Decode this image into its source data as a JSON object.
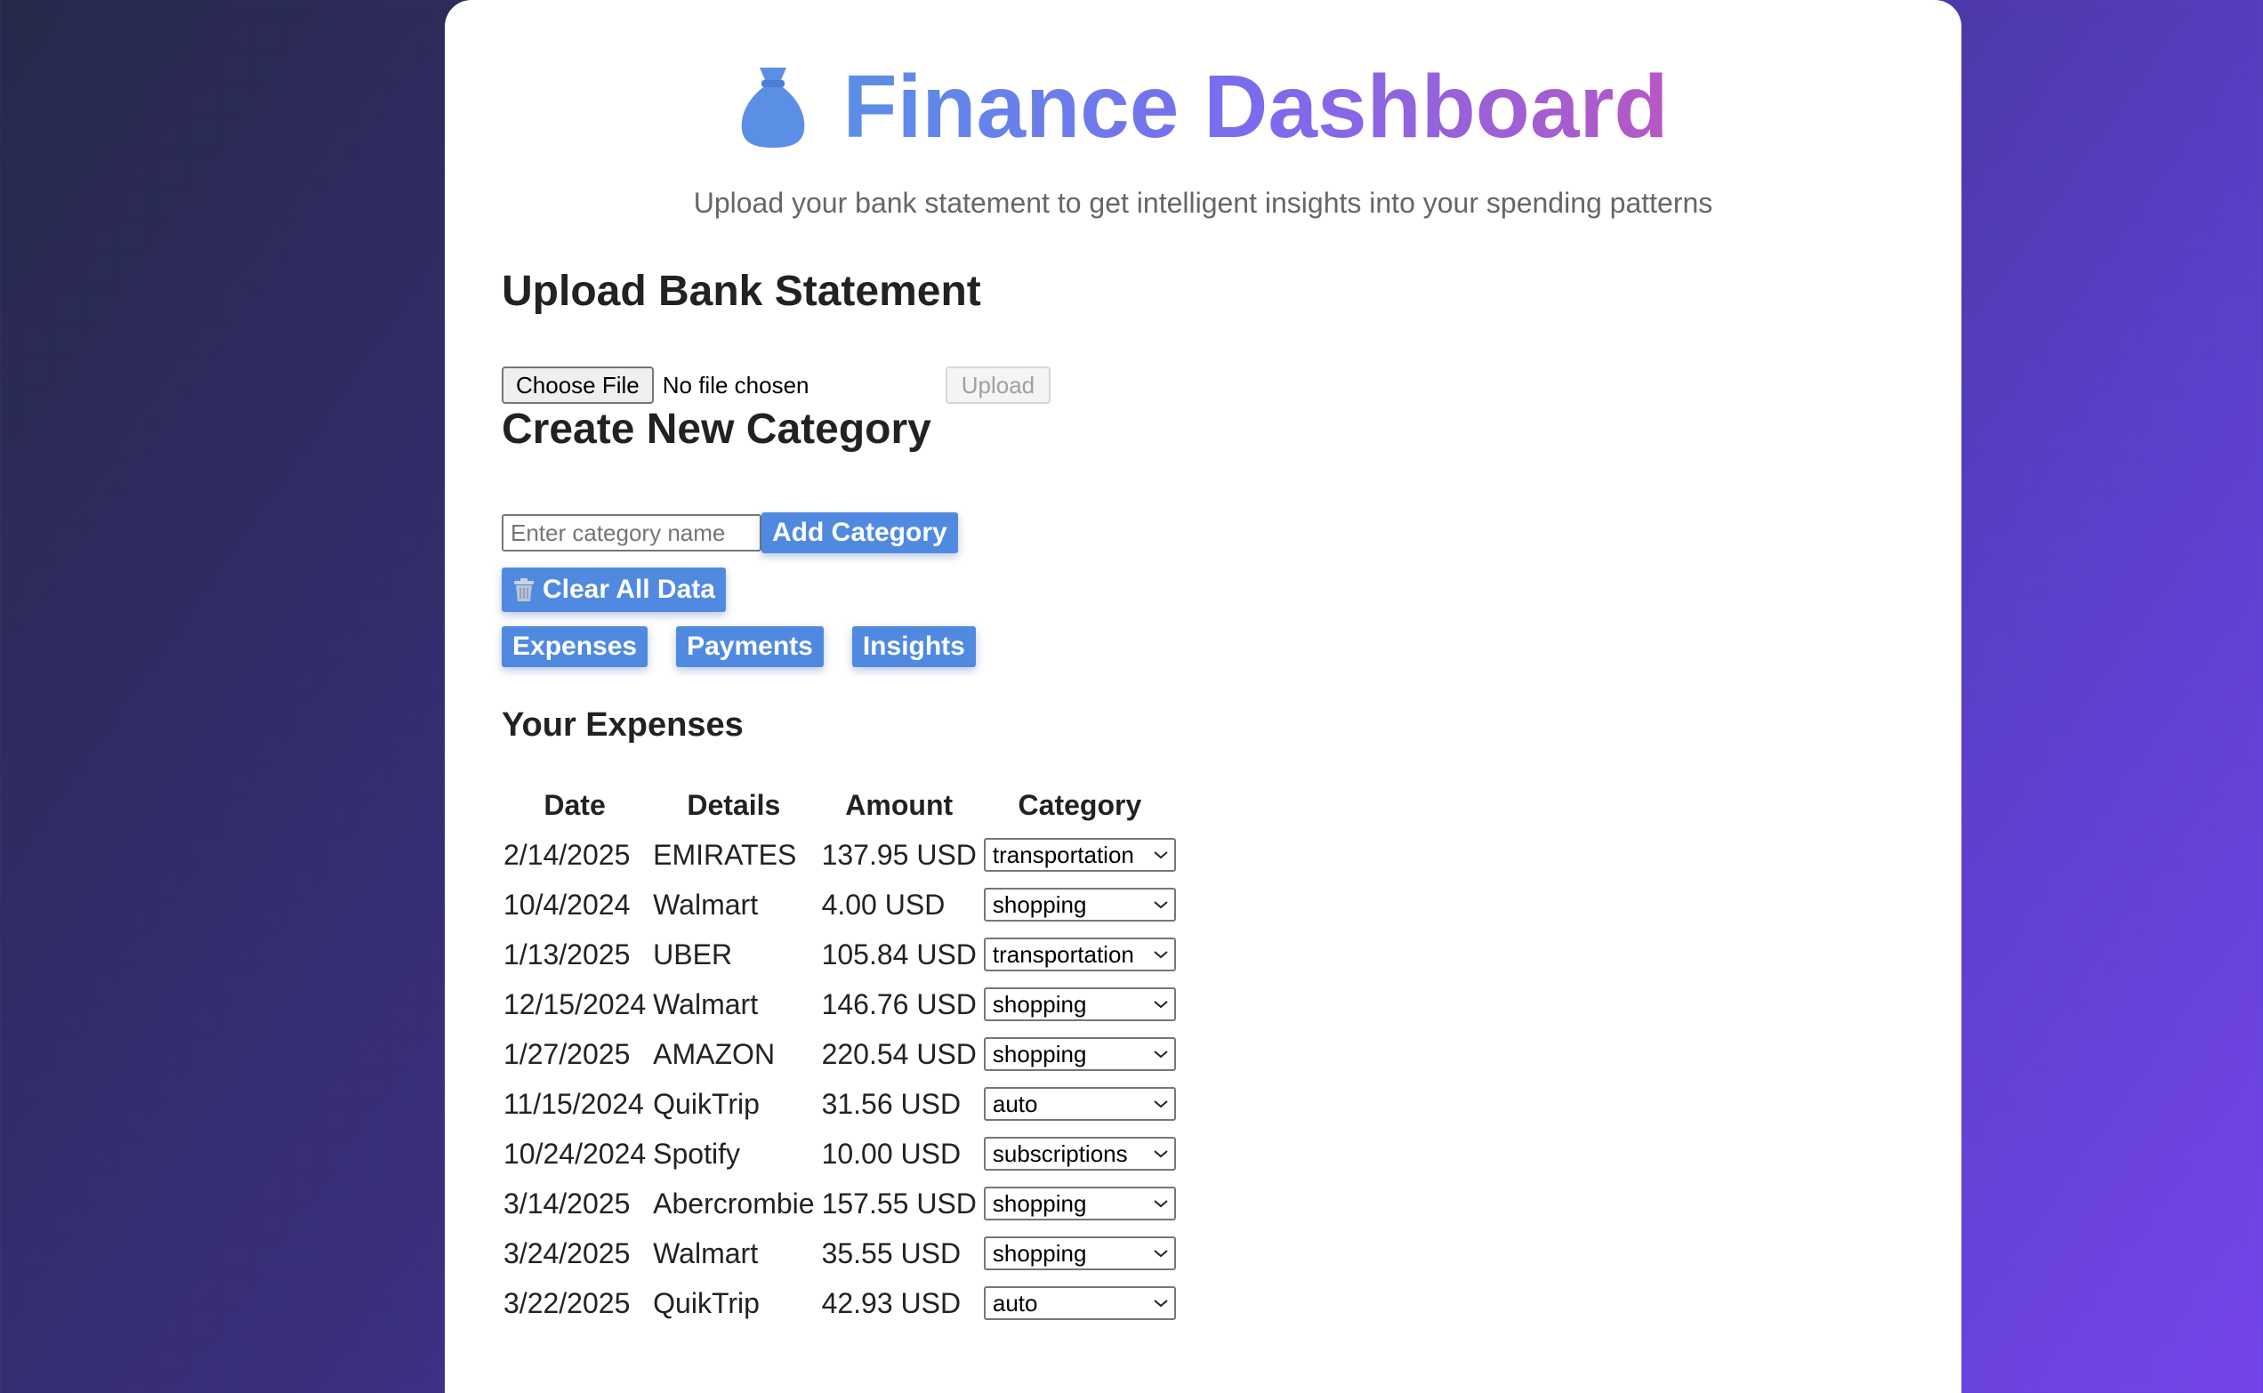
{
  "header": {
    "title": "Finance Dashboard",
    "subtitle": "Upload your bank statement to get intelligent insights into your spending patterns",
    "icon": "money-bag-icon"
  },
  "upload": {
    "heading": "Upload Bank Statement",
    "choose_file_label": "Choose File",
    "file_status": "No file chosen",
    "upload_label": "Upload"
  },
  "category": {
    "heading": "Create New Category",
    "input_placeholder": "Enter category name",
    "add_label": "Add Category"
  },
  "clear_label": "Clear All Data",
  "tabs": [
    {
      "label": "Expenses"
    },
    {
      "label": "Payments"
    },
    {
      "label": "Insights"
    }
  ],
  "expenses": {
    "heading": "Your Expenses",
    "columns": [
      "Date",
      "Details",
      "Amount",
      "Category"
    ],
    "rows": [
      {
        "date": "2/14/2025",
        "details": "EMIRATES",
        "amount": "137.95 USD",
        "category": "transportation"
      },
      {
        "date": "10/4/2024",
        "details": "Walmart",
        "amount": "4.00 USD",
        "category": "shopping"
      },
      {
        "date": "1/13/2025",
        "details": "UBER",
        "amount": "105.84 USD",
        "category": "transportation"
      },
      {
        "date": "12/15/2024",
        "details": "Walmart",
        "amount": "146.76 USD",
        "category": "shopping"
      },
      {
        "date": "1/27/2025",
        "details": "AMAZON",
        "amount": "220.54 USD",
        "category": "shopping"
      },
      {
        "date": "11/15/2024",
        "details": "QuikTrip",
        "amount": "31.56 USD",
        "category": "auto"
      },
      {
        "date": "10/24/2024",
        "details": "Spotify",
        "amount": "10.00 USD",
        "category": "subscriptions"
      },
      {
        "date": "3/14/2025",
        "details": "Abercrombie",
        "amount": "157.55 USD",
        "category": "shopping"
      },
      {
        "date": "3/24/2025",
        "details": "Walmart",
        "amount": "35.55 USD",
        "category": "shopping"
      },
      {
        "date": "3/22/2025",
        "details": "QuikTrip",
        "amount": "42.93 USD",
        "category": "auto"
      }
    ]
  },
  "colors": {
    "accent": "#4f8ae0",
    "title_gradient_start": "#5b8fe6",
    "title_gradient_end": "#b658c4"
  }
}
